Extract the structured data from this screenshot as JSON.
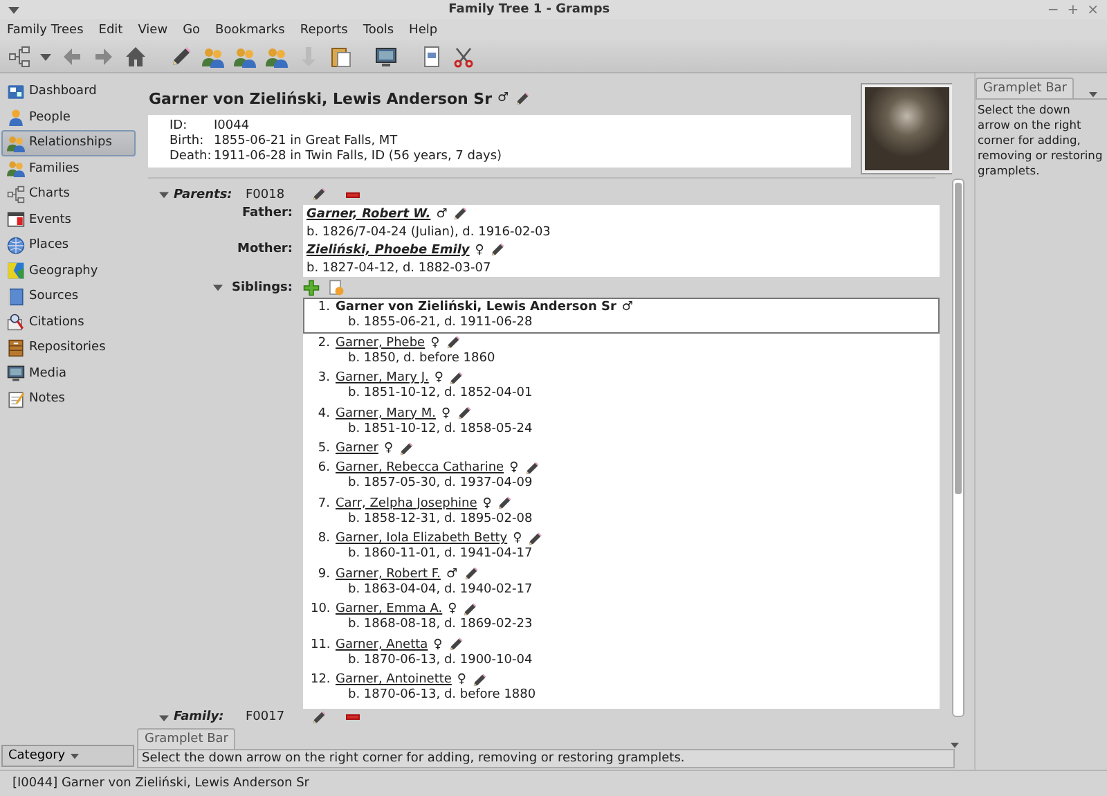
{
  "window": {
    "title": "Family Tree 1 - Gramps",
    "controls": [
      "−",
      "+",
      "×"
    ]
  },
  "menu": [
    "Family Trees",
    "Edit",
    "View",
    "Go",
    "Bookmarks",
    "Reports",
    "Tools",
    "Help"
  ],
  "sidebar": {
    "items": [
      {
        "label": "Dashboard",
        "selected": false
      },
      {
        "label": "People",
        "selected": false
      },
      {
        "label": "Relationships",
        "selected": true
      },
      {
        "label": "Families",
        "selected": false
      },
      {
        "label": "Charts",
        "selected": false
      },
      {
        "label": "Events",
        "selected": false
      },
      {
        "label": "Places",
        "selected": false
      },
      {
        "label": "Geography",
        "selected": false
      },
      {
        "label": "Sources",
        "selected": false
      },
      {
        "label": "Citations",
        "selected": false
      },
      {
        "label": "Repositories",
        "selected": false
      },
      {
        "label": "Media",
        "selected": false
      },
      {
        "label": "Notes",
        "selected": false
      }
    ],
    "category": "Category"
  },
  "person": {
    "name": "Garner von Zieliński, Lewis Anderson Sr",
    "gender": "♂",
    "fields": [
      {
        "label": "ID:",
        "value": "I0044"
      },
      {
        "label": "Birth:",
        "value": "1855-06-21 in Great Falls, MT"
      },
      {
        "label": "Death:",
        "value": "1911-06-28 in Twin Falls, ID (56 years, 7 days)"
      }
    ]
  },
  "parents": {
    "label": "Parents:",
    "family_id": "F0018",
    "expanded": true,
    "members": [
      {
        "role": "Father:",
        "name": "Garner, Robert W.",
        "gender": "♂",
        "dates": "b. 1826/7-04-24 (Julian), d. 1916-02-03"
      },
      {
        "role": "Mother:",
        "name": "Zieliński, Phoebe Emily",
        "gender": "♀",
        "dates": "b. 1827-04-12, d. 1882-03-07"
      }
    ]
  },
  "siblings": {
    "label": "Siblings:",
    "expanded": true,
    "items": [
      {
        "number": "1.",
        "name": "Garner von Zieliński, Lewis Anderson Sr",
        "gender": "♂",
        "dates": "b. 1855-06-21, d. 1911-06-28",
        "selected": true
      },
      {
        "number": "2.",
        "name": "Garner, Phebe",
        "gender": "♀",
        "dates": "b. 1850, d. before 1860",
        "selected": false
      },
      {
        "number": "3.",
        "name": "Garner, Mary J.",
        "gender": "♀",
        "dates": "b. 1851-10-12, d. 1852-04-01",
        "selected": false
      },
      {
        "number": "4.",
        "name": "Garner, Mary M.",
        "gender": "♀",
        "dates": "b. 1851-10-12, d. 1858-05-24",
        "selected": false
      },
      {
        "number": "5.",
        "name": "Garner",
        "gender": "♀",
        "selected": false
      },
      {
        "number": "6.",
        "name": "Garner, Rebecca Catharine",
        "gender": "♀",
        "dates": "b. 1857-05-30, d. 1937-04-09",
        "selected": false
      },
      {
        "number": "7.",
        "name": "Carr, Zelpha Josephine",
        "gender": "♀",
        "dates": "b. 1858-12-31, d. 1895-02-08",
        "selected": false
      },
      {
        "number": "8.",
        "name": "Garner, Iola Elizabeth Betty",
        "gender": "♀",
        "dates": "b. 1860-11-01, d. 1941-04-17",
        "selected": false
      },
      {
        "number": "9.",
        "name": "Garner, Robert F.",
        "gender": "♂",
        "dates": "b. 1863-04-04, d. 1940-02-17",
        "selected": false
      },
      {
        "number": "10.",
        "name": "Garner, Emma A.",
        "gender": "♀",
        "dates": "b. 1868-08-18, d. 1869-02-23",
        "selected": false
      },
      {
        "number": "11.",
        "name": "Garner, Anetta",
        "gender": "♀",
        "dates": "b. 1870-06-13, d. 1900-10-04",
        "selected": false
      },
      {
        "number": "12.",
        "name": "Garner, Antoinette",
        "gender": "♀",
        "dates": "b. 1870-06-13, d. before 1880",
        "selected": false
      }
    ]
  },
  "family": {
    "label": "Family:",
    "family_id": "F0017",
    "expanded": true
  },
  "gramplet_side": {
    "tab": "Gramplet Bar",
    "text": "Select the down arrow on the right corner for adding, removing or restoring gramplets."
  },
  "gramplet_bottom": {
    "tab": "Gramplet Bar",
    "text": "Select the down arrow on the right corner for adding, removing or restoring gramplets."
  },
  "status_bar": "[I0044] Garner von Zieliński, Lewis Anderson Sr"
}
